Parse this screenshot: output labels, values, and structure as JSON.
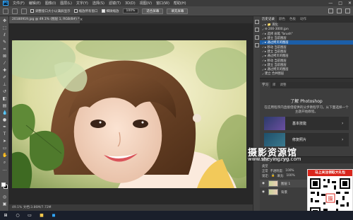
{
  "menu": {
    "logo": "Ps",
    "items": [
      "文件(F)",
      "编辑(E)",
      "图像(I)",
      "图层(L)",
      "文字(Y)",
      "选择(S)",
      "滤镜(T)",
      "3D(D)",
      "视图(V)",
      "窗口(W)",
      "帮助(H)"
    ],
    "window_controls": [
      "—",
      "□",
      "✕"
    ]
  },
  "options": {
    "resize_windows": "调整窗口大小以满屏显示",
    "zoom_all": "缩放所有窗口",
    "scrubby_zoom": "细微缩放",
    "zoom_value": "100%",
    "fit_screen": "适合屏幕",
    "fill_screen": "填充屏幕"
  },
  "document": {
    "tab_title": "20180919.jpg @ 49.1% (图层 1, RGB/8#) *",
    "close": "×",
    "status": "49.1%    文档:3.86M/7.72M"
  },
  "history": {
    "tabs": [
      "历史记录",
      "颜色",
      "色板",
      "动作"
    ],
    "rows": [
      {
        "text": "▸ 📁 液化",
        "sel": false
      },
      {
        "text": "⊖ 200-3000.jpn",
        "sel": false
      },
      {
        "text": "  ▸ 选择 画笔 \"brush\"",
        "sel": false
      },
      {
        "text": "  ▸ 建立 当前图层",
        "sel": false
      },
      {
        "text": "  ▸ 通过拷贝的图层",
        "sel": true
      },
      {
        "text": "  ▸ 移动 当前图层",
        "sel": false
      },
      {
        "text": "  ▸ 建立 当前图层",
        "sel": false
      },
      {
        "text": "  ▸ 通过拷贝的图层",
        "sel": false
      },
      {
        "text": "  ▸ 移动 当前图层",
        "sel": false
      },
      {
        "text": "  ▸ 建立 当前图层",
        "sel": false
      },
      {
        "text": "  ▸ 通过拷贝的图层",
        "sel": false
      },
      {
        "text": "    建立 合并图层",
        "sel": false
      }
    ]
  },
  "learn": {
    "tabs": [
      "学习",
      "库",
      "调整"
    ],
    "title": "了解 Photoshop",
    "desc": "在应用程序内直接借提供的分步教程学习。从下面选择一个主题开始教程。",
    "cards": [
      {
        "label": "基本技能",
        "arrow": "›"
      },
      {
        "label": "修复照片",
        "arrow": "›"
      }
    ]
  },
  "layers": {
    "tabs": [
      "图层",
      "通道",
      "路径"
    ],
    "kind_label": "类型",
    "blend": "正常",
    "opacity_label": "不透明度:",
    "opacity": "100%",
    "lock_label": "锁定:",
    "fill_label": "填充:",
    "fill": "100%",
    "items": [
      {
        "name": "图层 1"
      },
      {
        "name": "背景"
      }
    ]
  },
  "watermark": {
    "cn": "摄影资源馆",
    "url": "www.sheyingzyg.com"
  },
  "qr": {
    "banner": "马上关注领取大礼包"
  },
  "colors": {
    "accent": "#1b5ea8",
    "banner_red": "#d9251b",
    "panel": "#3d3d3d",
    "workspace": "#282828"
  }
}
